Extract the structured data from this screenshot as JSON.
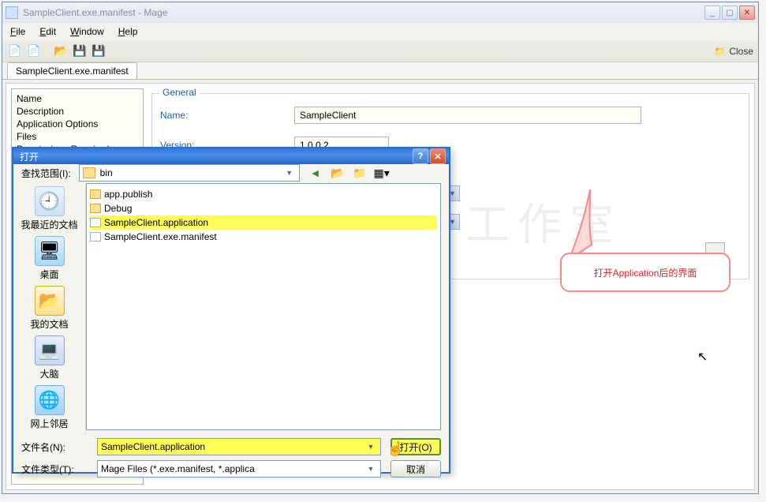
{
  "window": {
    "title": "SampleClient.exe.manifest - Mage",
    "min": "_",
    "max": "▢",
    "close": "✕"
  },
  "menu": {
    "file": "File",
    "edit": "Edit",
    "window": "Window",
    "help": "Help"
  },
  "toolbar": {
    "close_label": "Close"
  },
  "tabs": {
    "doc": "SampleClient.exe.manifest"
  },
  "sidebar": {
    "items": [
      "Name",
      "Description",
      "Application Options",
      "Files",
      "Permissions Required"
    ]
  },
  "general": {
    "legend": "General",
    "name_label": "Name:",
    "name_value": "SampleClient",
    "version_label": "Version:",
    "version_value": "1.0.0.2"
  },
  "dialog": {
    "title": "打开",
    "help": "?",
    "close": "✕",
    "lookin_label": "查找范围(I):",
    "lookin_value": "bin",
    "places": {
      "recent": "我最近的文档",
      "desktop": "桌面",
      "mydocs": "我的文档",
      "computer": "大脑",
      "network": "网上邻居"
    },
    "files": [
      {
        "name": "app.publish",
        "type": "folder"
      },
      {
        "name": "Debug",
        "type": "folder"
      },
      {
        "name": "SampleClient.application",
        "type": "app",
        "selected": true
      },
      {
        "name": "SampleClient.exe.manifest",
        "type": "app",
        "selected": false
      }
    ],
    "filename_label": "文件名(N):",
    "filename_value": "SampleClient.application",
    "filetype_label": "文件类型(T):",
    "filetype_value": "Mage Files (*.exe.manifest, *.applica",
    "open_btn": "打开(O)",
    "cancel_btn": "取消"
  },
  "callout": {
    "text": "打开Application后的界面"
  },
  "watermark": "工作室"
}
